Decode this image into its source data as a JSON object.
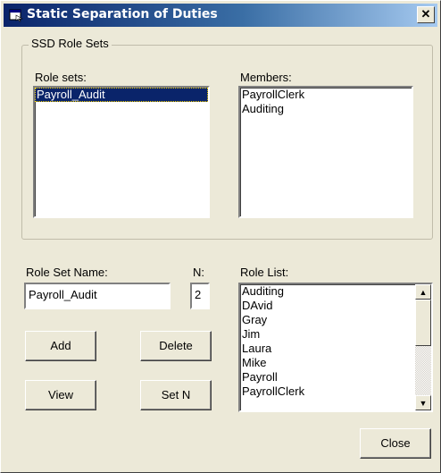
{
  "window": {
    "title": "Static Separation of Duties",
    "close_glyph": "✕"
  },
  "group": {
    "legend": "SSD Role Sets"
  },
  "role_sets": {
    "label": "Role sets:",
    "items": [
      "Payroll_Audit"
    ],
    "selected_index": 0
  },
  "members": {
    "label": "Members:",
    "items": [
      "PayrollClerk",
      "Auditing"
    ]
  },
  "role_set_name": {
    "label": "Role Set Name:",
    "value": "Payroll_Audit"
  },
  "n_field": {
    "label": "N:",
    "value": "2"
  },
  "role_list": {
    "label": "Role List:",
    "items": [
      "Auditing",
      "DAvid",
      "Gray",
      "Jim",
      "Laura",
      "Mike",
      "Payroll",
      "PayrollClerk"
    ]
  },
  "buttons": {
    "add": "Add",
    "delete": "Delete",
    "view": "View",
    "set_n": "Set N",
    "close": "Close"
  },
  "icons": {
    "app": "window-app-icon",
    "close": "close-icon",
    "scroll_up": "scroll-up-arrow-icon",
    "scroll_down": "scroll-down-arrow-icon"
  }
}
